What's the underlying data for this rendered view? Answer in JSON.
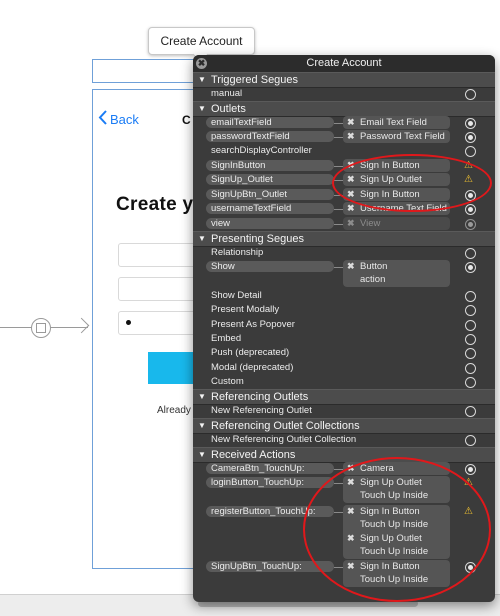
{
  "tooltip": "Create Account",
  "scene": {
    "back_label": "Back",
    "nav_title": "C",
    "big_title": "Create y",
    "password_dot": "•",
    "already_text": "Already"
  },
  "panel": {
    "title": "Create Account",
    "close_symbol": "✖",
    "x_symbol": "✖",
    "warn_symbol": "⚠"
  },
  "sections": {
    "triggered_segues": "Triggered Segues",
    "outlets": "Outlets",
    "presenting_segues": "Presenting Segues",
    "referencing_outlets": "Referencing Outlets",
    "referencing_outlet_collections": "Referencing Outlet Collections",
    "received_actions": "Received Actions"
  },
  "triggered_segues": [
    {
      "label": "manual"
    }
  ],
  "outlets": [
    {
      "label": "emailTextField",
      "target": "Email Text Field",
      "status": "filled"
    },
    {
      "label": "passwordTextField",
      "target": "Password Text Field",
      "status": "filled"
    },
    {
      "label": "searchDisplayController",
      "target": "",
      "status": "empty"
    },
    {
      "label": "SignInButton",
      "target": "Sign In Button",
      "status": "warning"
    },
    {
      "label": "SignUp_Outlet",
      "target": "Sign Up Outlet",
      "status": "warning"
    },
    {
      "label": "SignUpBtn_Outlet",
      "target": "Sign In Button",
      "status": "filled"
    },
    {
      "label": "usernameTextField",
      "target": "Username Text Field",
      "status": "filled"
    },
    {
      "label": "view",
      "target": "View",
      "status": "filled-dim"
    }
  ],
  "presenting_segues": [
    {
      "label": "Relationship"
    },
    {
      "label": "Show",
      "target_lines": [
        "Button",
        "action"
      ]
    },
    {
      "label": "Show Detail"
    },
    {
      "label": "Present Modally"
    },
    {
      "label": "Present As Popover"
    },
    {
      "label": "Embed"
    },
    {
      "label": "Push (deprecated)"
    },
    {
      "label": "Modal (deprecated)"
    },
    {
      "label": "Custom"
    }
  ],
  "referencing_outlets": [
    {
      "label": "New Referencing Outlet"
    }
  ],
  "referencing_outlet_collections": [
    {
      "label": "New Referencing Outlet Collection"
    }
  ],
  "received_actions": [
    {
      "label": "CameraBtn_TouchUp:",
      "targets": [
        [
          "Camera"
        ]
      ],
      "status": "filled"
    },
    {
      "label": "loginButton_TouchUp:",
      "targets": [
        [
          "Sign Up Outlet",
          "Touch Up Inside"
        ]
      ],
      "status": "warning"
    },
    {
      "label": "registerButton_TouchUp:",
      "targets": [
        [
          "Sign In Button",
          "Touch Up Inside"
        ],
        [
          "Sign Up Outlet",
          "Touch Up Inside"
        ]
      ],
      "status": "warning"
    },
    {
      "label": "SignUpBtn_TouchUp:",
      "targets": [
        [
          "Sign In Button",
          "Touch Up Inside"
        ]
      ],
      "status": "filled"
    }
  ],
  "colors": {
    "panel_bg": "#3b3b3b",
    "section_bg": "#4c4c4c",
    "annotation_ring": "#e0181b",
    "warning": "#f2c230",
    "link_blue": "#1a7cf5",
    "button_cyan": "#18b8ec"
  }
}
